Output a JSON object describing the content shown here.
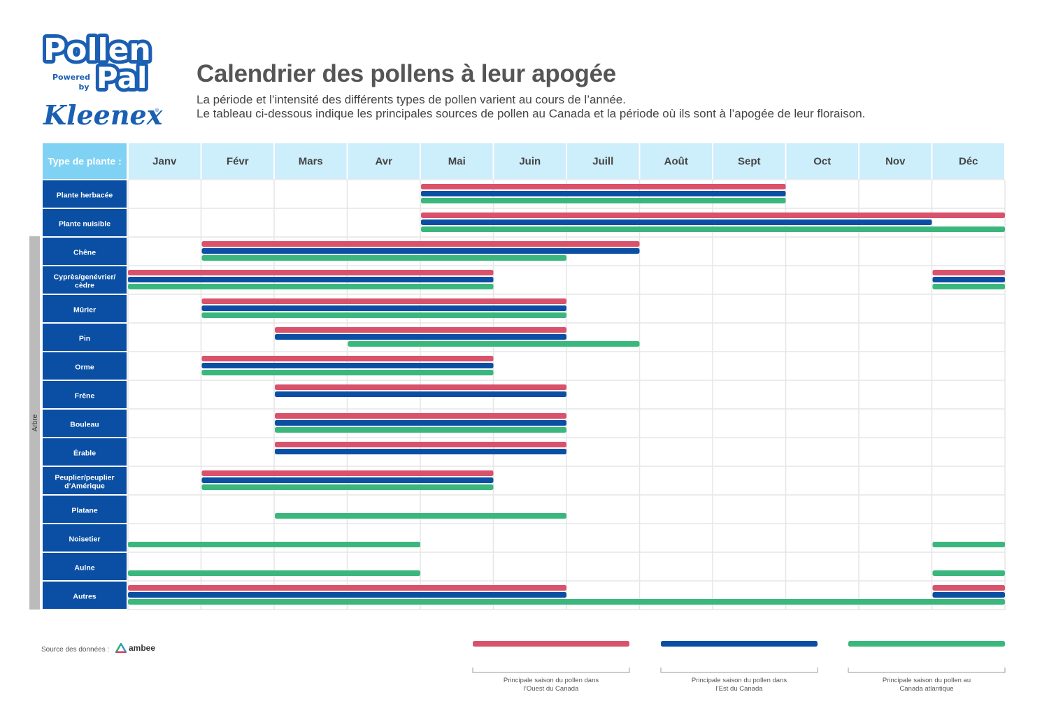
{
  "logo": {
    "brand": "Pollen",
    "brand2": "Pal",
    "powered": "Powered",
    "by": "by",
    "partner": "Kleenex",
    "reg": "®"
  },
  "header": {
    "title": "Calendrier des pollens à leur apogée",
    "subtitle_line1": "La période et l’intensité des différents types de pollen varient au cours de l’année.",
    "subtitle_line2": "Le tableau ci-dessous indique les principales sources de pollen au Canada et la période où ils sont à l’apogée de leur floraison."
  },
  "footer": {
    "source_label": "Source des données :",
    "source_brand": "ambee"
  },
  "colors": {
    "west": "#d9526b",
    "east": "#0a4fa3",
    "atlantic": "#3bb77e",
    "label_bg": "#0a4fa3",
    "header_bg": "#cdeefb",
    "header_label_bg": "#7fd2f3",
    "grid": "#e6e6e6",
    "group_bar": "#bbbbbb"
  },
  "chart_data": {
    "type": "gantt",
    "title": "Calendrier des pollens à leur apogée",
    "row_header": "Type de plante :",
    "categories": [
      "Janv",
      "Févr",
      "Mars",
      "Avr",
      "Mai",
      "Juin",
      "Juill",
      "Août",
      "Sept",
      "Oct",
      "Nov",
      "Déc"
    ],
    "group_label": "Arbre",
    "group_rows": [
      2,
      14
    ],
    "series": [
      {
        "key": "west",
        "name": "Principale saison du pollen dans l’Ouest du Canada",
        "name_line1": "Principale saison du pollen dans",
        "name_line2": "l’Ouest du Canada"
      },
      {
        "key": "east",
        "name": "Principale saison du pollen dans l’Est du Canada",
        "name_line1": "Principale saison du pollen dans",
        "name_line2": "l’Est du Canada"
      },
      {
        "key": "atlantic",
        "name": "Principale saison du pollen au Canada atlantique",
        "name_line1": "Principale saison du pollen au",
        "name_line2": "Canada atlantique"
      }
    ],
    "rows": [
      {
        "label": [
          "Plante herbacée"
        ],
        "west": [
          [
            "Mai",
            "Sept"
          ]
        ],
        "east": [
          [
            "Mai",
            "Sept"
          ]
        ],
        "atlantic": [
          [
            "Mai",
            "Sept"
          ]
        ]
      },
      {
        "label": [
          "Plante nuisible"
        ],
        "west": [
          [
            "Mai",
            "Déc"
          ]
        ],
        "east": [
          [
            "Mai",
            "Nov"
          ]
        ],
        "atlantic": [
          [
            "Mai",
            "Déc"
          ]
        ]
      },
      {
        "label": [
          "Chêne"
        ],
        "west": [
          [
            "Févr",
            "Juill"
          ]
        ],
        "east": [
          [
            "Févr",
            "Juill"
          ]
        ],
        "atlantic": [
          [
            "Févr",
            "Juin"
          ]
        ]
      },
      {
        "label": [
          "Cyprès/genévrier/",
          "cèdre"
        ],
        "west": [
          [
            "Janv",
            "Mai"
          ],
          [
            "Déc",
            "Déc"
          ]
        ],
        "east": [
          [
            "Janv",
            "Mai"
          ],
          [
            "Déc",
            "Déc"
          ]
        ],
        "atlantic": [
          [
            "Janv",
            "Mai"
          ],
          [
            "Déc",
            "Déc"
          ]
        ]
      },
      {
        "label": [
          "Mûrier"
        ],
        "west": [
          [
            "Févr",
            "Juin"
          ]
        ],
        "east": [
          [
            "Févr",
            "Juin"
          ]
        ],
        "atlantic": [
          [
            "Févr",
            "Juin"
          ]
        ]
      },
      {
        "label": [
          "Pin"
        ],
        "west": [
          [
            "Mars",
            "Juin"
          ]
        ],
        "east": [
          [
            "Mars",
            "Juin"
          ]
        ],
        "atlantic": [
          [
            "Avr",
            "Juill"
          ]
        ]
      },
      {
        "label": [
          "Orme"
        ],
        "west": [
          [
            "Févr",
            "Mai"
          ]
        ],
        "east": [
          [
            "Févr",
            "Mai"
          ]
        ],
        "atlantic": [
          [
            "Févr",
            "Mai"
          ]
        ]
      },
      {
        "label": [
          "Frêne"
        ],
        "west": [
          [
            "Mars",
            "Juin"
          ]
        ],
        "east": [
          [
            "Mars",
            "Juin"
          ]
        ],
        "atlantic": []
      },
      {
        "label": [
          "Bouleau"
        ],
        "west": [
          [
            "Mars",
            "Juin"
          ]
        ],
        "east": [
          [
            "Mars",
            "Juin"
          ]
        ],
        "atlantic": [
          [
            "Mars",
            "Juin"
          ]
        ]
      },
      {
        "label": [
          "Érable"
        ],
        "west": [
          [
            "Mars",
            "Juin"
          ]
        ],
        "east": [
          [
            "Mars",
            "Juin"
          ]
        ],
        "atlantic": []
      },
      {
        "label": [
          "Peuplier/peuplier",
          "d’Amérique"
        ],
        "west": [
          [
            "Févr",
            "Mai"
          ]
        ],
        "east": [
          [
            "Févr",
            "Mai"
          ]
        ],
        "atlantic": [
          [
            "Févr",
            "Mai"
          ]
        ]
      },
      {
        "label": [
          "Platane"
        ],
        "west": [],
        "east": [],
        "atlantic": [
          [
            "Mars",
            "Juin"
          ]
        ]
      },
      {
        "label": [
          "Noisetier"
        ],
        "west": [],
        "east": [],
        "atlantic": [
          [
            "Janv",
            "Avr"
          ],
          [
            "Déc",
            "Déc"
          ]
        ]
      },
      {
        "label": [
          "Aulne"
        ],
        "west": [],
        "east": [],
        "atlantic": [
          [
            "Janv",
            "Avr"
          ],
          [
            "Déc",
            "Déc"
          ]
        ]
      },
      {
        "label": [
          "Autres"
        ],
        "west": [
          [
            "Janv",
            "Juin"
          ],
          [
            "Déc",
            "Déc"
          ]
        ],
        "east": [
          [
            "Janv",
            "Juin"
          ],
          [
            "Déc",
            "Déc"
          ]
        ],
        "atlantic": [
          [
            "Janv",
            "Déc"
          ]
        ]
      }
    ]
  }
}
